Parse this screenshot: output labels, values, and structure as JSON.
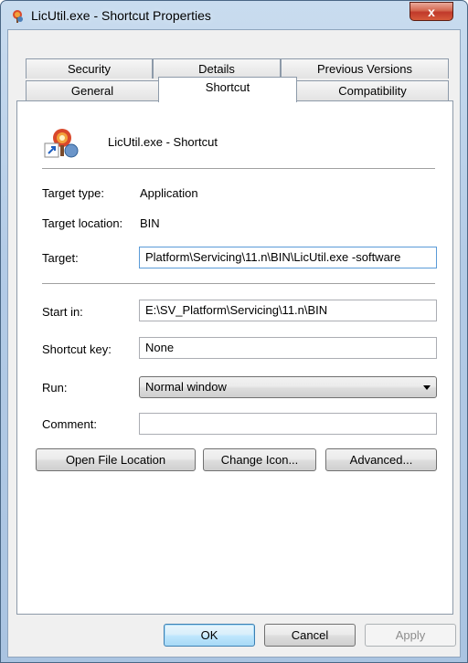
{
  "window": {
    "title": "LicUtil.exe - Shortcut Properties",
    "close_label": "x"
  },
  "tabs": {
    "row1": [
      "Security",
      "Details",
      "Previous Versions"
    ],
    "row2": [
      "General",
      "Shortcut",
      "Compatibility"
    ],
    "active": "Shortcut"
  },
  "header": {
    "name": "LicUtil.exe - Shortcut"
  },
  "fields": {
    "target_type_label": "Target type:",
    "target_type_value": "Application",
    "target_location_label": "Target location:",
    "target_location_value": "BIN",
    "target_label": "Target:",
    "target_value": "Platform\\Servicing\\11.n\\BIN\\LicUtil.exe -software",
    "start_in_label": "Start in:",
    "start_in_value": "E:\\SV_Platform\\Servicing\\11.n\\BIN",
    "shortcut_key_label": "Shortcut key:",
    "shortcut_key_value": "None",
    "run_label": "Run:",
    "run_value": "Normal window",
    "comment_label": "Comment:",
    "comment_value": ""
  },
  "buttons": {
    "open_file_location": "Open File Location",
    "change_icon": "Change Icon...",
    "advanced": "Advanced...",
    "ok": "OK",
    "cancel": "Cancel",
    "apply": "Apply"
  },
  "colors": {
    "frame": "#b3cbe6",
    "close_button": "#c0392b",
    "default_button": "#3c7fb1"
  }
}
